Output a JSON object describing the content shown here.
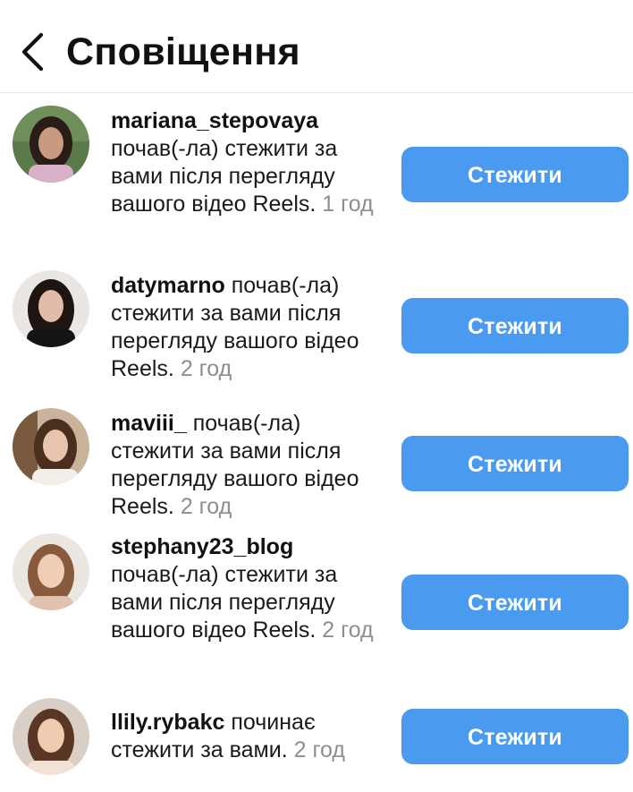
{
  "header": {
    "title": "Сповіщення"
  },
  "notifications": [
    {
      "username": "mariana_stepovaya",
      "message": "почав(-ла) стежити за вами після перегляду вашого відео Reels.",
      "time": "1 год",
      "button": "Стежити"
    },
    {
      "username": "datymarno",
      "message": "почав(-ла) стежити за вами після перегляду вашого відео Reels.",
      "time": "2 год",
      "button": "Стежити"
    },
    {
      "username": "maviii_",
      "message": "почав(-ла) стежити за вами після перегляду вашого відео Reels.",
      "time": "2 год",
      "button": "Стежити"
    },
    {
      "username": "stephany23_blog",
      "message": "почав(-ла) стежити за вами після перегляду вашого відео Reels.",
      "time": "2 год",
      "button": "Стежити"
    },
    {
      "username": "llily.rybakc",
      "message": "починає стежити за вами.",
      "time": "2 год",
      "button": "Стежити"
    }
  ],
  "colors": {
    "follow_button": "#4a9af0",
    "timestamp": "#8e8e8e"
  },
  "icons": {
    "back": "chevron-left-icon"
  }
}
